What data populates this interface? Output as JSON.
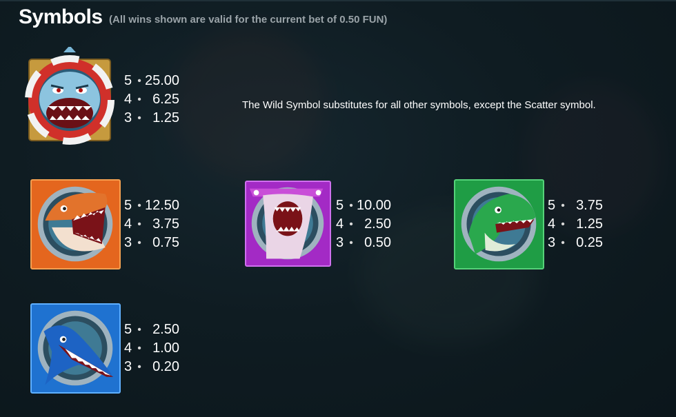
{
  "header": {
    "title": "Symbols",
    "subtitle": "(All wins shown are valid for the current bet of 0.50 FUN)"
  },
  "wild_description": "The Wild Symbol substitutes for all other symbols, except the Scatter symbol.",
  "symbols": [
    {
      "id": "wild-shark",
      "icon": "wild-shark-lifebuoy-icon",
      "border_color": "#c8a040",
      "payouts": [
        {
          "count": "5",
          "value": "25.00"
        },
        {
          "count": "4",
          "value": "6.25"
        },
        {
          "count": "3",
          "value": "1.25"
        }
      ]
    },
    {
      "id": "orange-shark",
      "icon": "orange-shark-icon",
      "border_color": "#e0601a",
      "payouts": [
        {
          "count": "5",
          "value": "12.50"
        },
        {
          "count": "4",
          "value": "3.75"
        },
        {
          "count": "3",
          "value": "0.75"
        }
      ]
    },
    {
      "id": "pink-shark",
      "icon": "pink-hammerhead-shark-icon",
      "border_color": "#b02ad0",
      "payouts": [
        {
          "count": "5",
          "value": "10.00"
        },
        {
          "count": "4",
          "value": "2.50"
        },
        {
          "count": "3",
          "value": "0.50"
        }
      ]
    },
    {
      "id": "green-shark",
      "icon": "green-shark-icon",
      "border_color": "#1fa84a",
      "payouts": [
        {
          "count": "5",
          "value": "3.75"
        },
        {
          "count": "4",
          "value": "1.25"
        },
        {
          "count": "3",
          "value": "0.25"
        }
      ]
    },
    {
      "id": "blue-shark",
      "icon": "blue-swordfish-shark-icon",
      "border_color": "#1f7fe0",
      "payouts": [
        {
          "count": "5",
          "value": "2.50"
        },
        {
          "count": "4",
          "value": "1.00"
        },
        {
          "count": "3",
          "value": "0.20"
        }
      ]
    }
  ],
  "separator_glyph": "•"
}
